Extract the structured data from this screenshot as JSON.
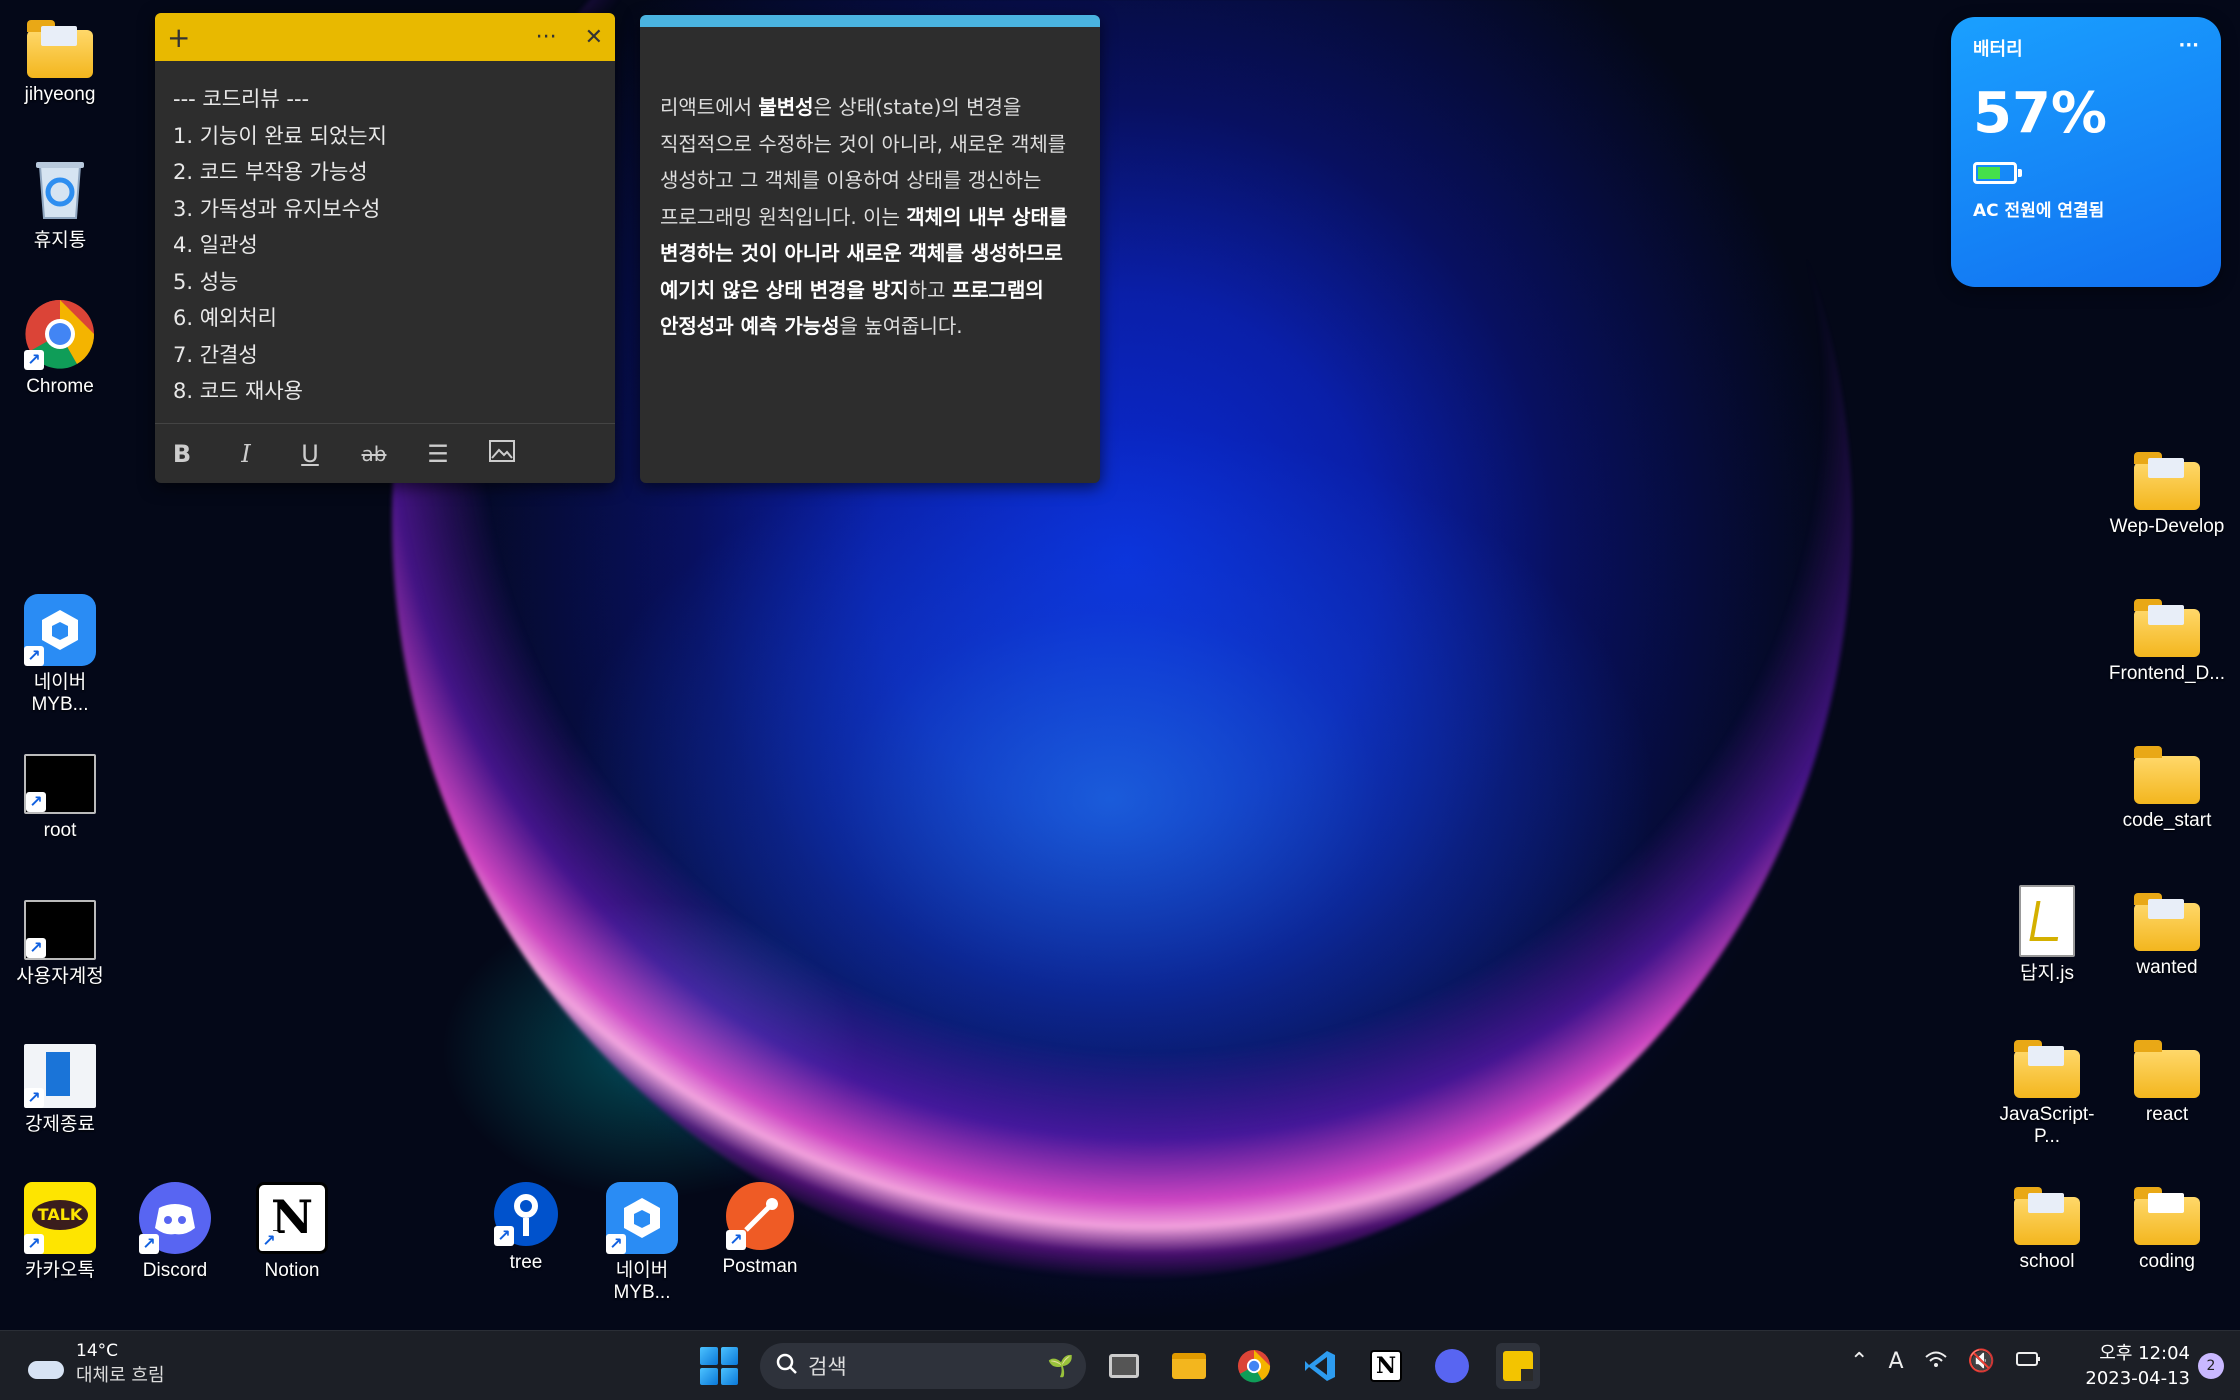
{
  "desktop": {
    "left_icons": [
      {
        "label": "jihyeong",
        "icon": "folder-icon"
      },
      {
        "label": "휴지통",
        "icon": "recycle-bin-icon"
      },
      {
        "label": "Chrome",
        "icon": "chrome-icon"
      },
      {
        "label": "네이버\nMYB...",
        "icon": "naver-myb-icon"
      },
      {
        "label": "root",
        "icon": "terminal-icon"
      },
      {
        "label": "사용자계정",
        "icon": "terminal-icon"
      },
      {
        "label": "강제종료",
        "icon": "app-icon"
      },
      {
        "label": "카카오톡",
        "icon": "kakaotalk-icon"
      }
    ],
    "bottom_icons": [
      {
        "label": "Discord",
        "icon": "discord-icon"
      },
      {
        "label": "Notion",
        "icon": "notion-icon"
      },
      {
        "label": "tree",
        "icon": "sourcetree-icon"
      },
      {
        "label": "네이버\nMYB...",
        "icon": "naver-myb-icon"
      },
      {
        "label": "Postman",
        "icon": "postman-icon"
      }
    ],
    "right_icons": [
      {
        "label": "Wep-Develop",
        "icon": "folder-icon"
      },
      {
        "label": "Frontend_D...",
        "icon": "folder-icon"
      },
      {
        "label": "code_start",
        "icon": "folder-icon"
      },
      {
        "label": "답지.js",
        "icon": "js-file-icon"
      },
      {
        "label": "wanted",
        "icon": "folder-icon"
      },
      {
        "label": "JavaScript-P...",
        "icon": "folder-icon"
      },
      {
        "label": "react",
        "icon": "folder-icon"
      },
      {
        "label": "school",
        "icon": "folder-icon"
      },
      {
        "label": "coding",
        "icon": "folder-icon"
      }
    ]
  },
  "sticky_note_1": {
    "add_label": "+",
    "more_label": "···",
    "close_label": "✕",
    "lines": [
      "--- 코드리뷰 ---",
      "1.  기능이 완료 되었는지",
      "2. 코드 부작용 가능성",
      "3. 가독성과 유지보수성",
      "4. 일관성",
      "5. 성능",
      "6. 예외처리",
      "7. 간결성",
      "8. 코드 재사용"
    ],
    "toolbar": [
      "B",
      "I",
      "U",
      "ab",
      "list",
      "image"
    ]
  },
  "sticky_note_2": {
    "p1": "리액트에서 ",
    "b1": "불변성",
    "p2": "은 상태(state)의 변경을 직접적으로 수정하는 것이 아니라, 새로운 객체를 생성하고 그 객체를 이용하여 상태를 갱신하는 프로그래밍 원칙입니다. 이는 ",
    "b2": "객체의 내부 상태를 변경하는 것이 아니라 새로운 객체를 생성하므로 예기치 않은 상태 변경을 방지",
    "p3": "하고 ",
    "b3": "프로그램의 안정성과 예측 가능성",
    "p4": "을 높여줍니다."
  },
  "battery_widget": {
    "title": "배터리",
    "more": "···",
    "percent": "57%",
    "level": 0.57,
    "status": "AC 전원에 연결됨"
  },
  "taskbar": {
    "weather_temp": "14°C",
    "weather_desc": "대체로 흐림",
    "search_placeholder": "검색",
    "time": "오후 12:04",
    "date": "2023-04-13",
    "notifications": "2",
    "ime": "A"
  }
}
